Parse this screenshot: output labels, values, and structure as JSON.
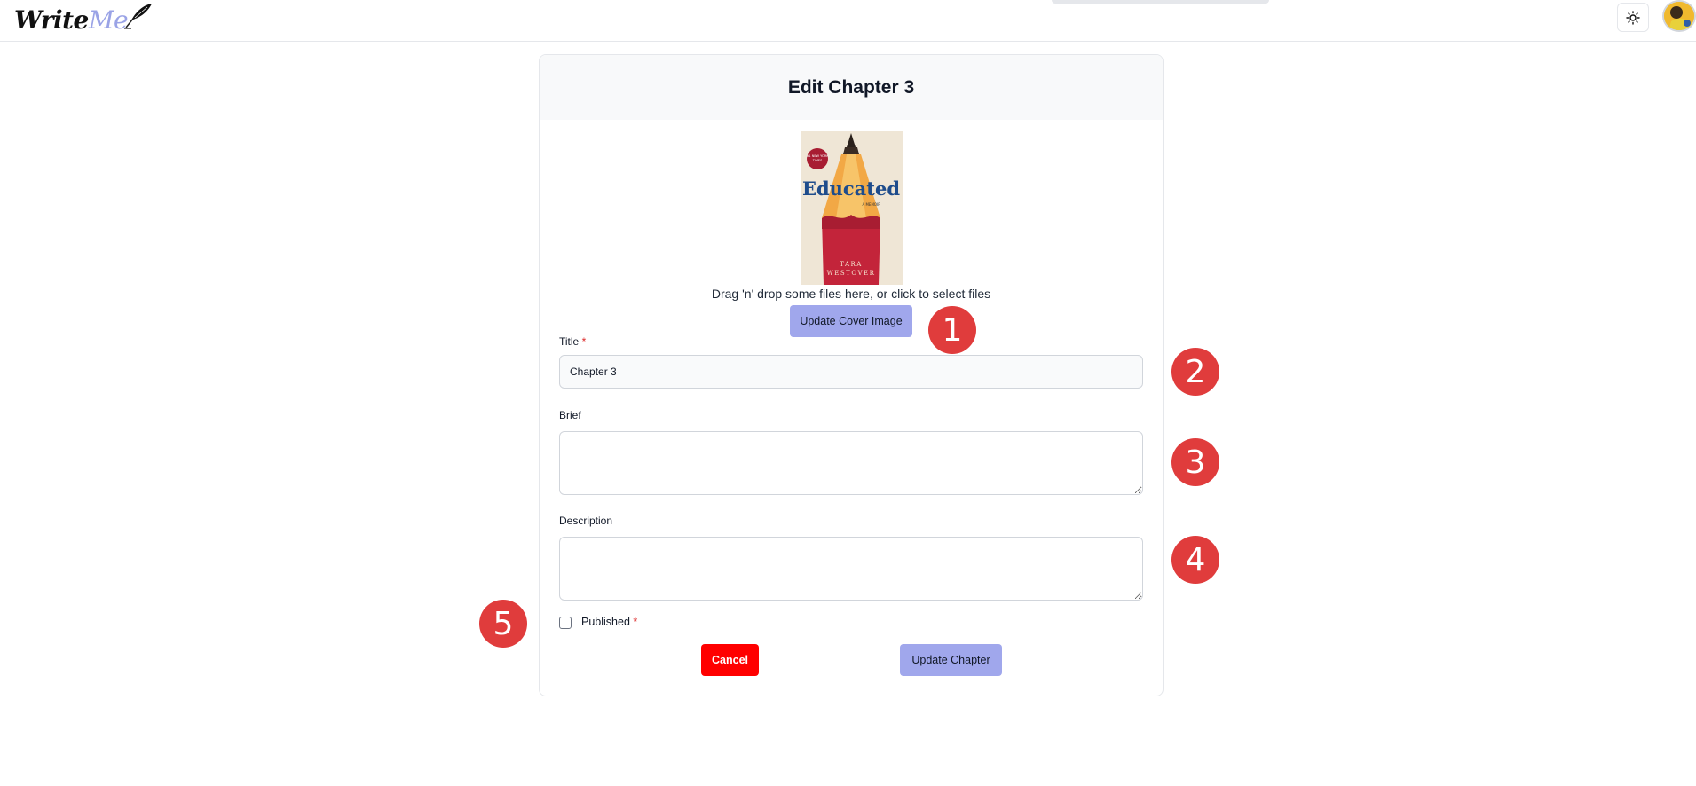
{
  "header": {
    "logo_write": "Write",
    "logo_me": "Me"
  },
  "form": {
    "heading": "Edit Chapter 3",
    "cover_book_title": "Educated",
    "cover_subtitle": "A MEMOIR",
    "cover_author_first": "TARA",
    "cover_author_last": "WESTOVER",
    "drop_text": "Drag 'n' drop some files here, or click to select files",
    "update_cover_label": "Update Cover Image",
    "title_label": "Title",
    "title_value": "Chapter 3",
    "brief_label": "Brief",
    "brief_value": "",
    "description_label": "Description",
    "description_value": "",
    "published_label": "Published",
    "published_checked": false,
    "required_mark": "*",
    "cancel_label": "Cancel",
    "update_chapter_label": "Update Chapter"
  },
  "annotations": [
    "1",
    "2",
    "3",
    "4",
    "5"
  ],
  "colors": {
    "accent_button": "#a0a7ec",
    "cancel_button": "#ff0000",
    "marker": "#e03c3c",
    "required": "#dc2626",
    "card_header_bg": "#f8f9fa"
  },
  "icons": {
    "theme_toggle": "sun-icon",
    "logo_mark": "quill-icon"
  }
}
